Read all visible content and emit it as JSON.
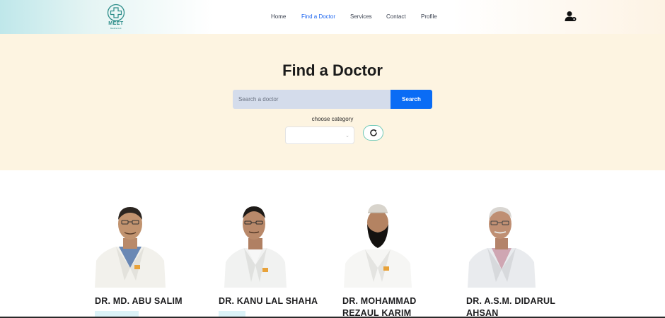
{
  "brand": {
    "logo_text": "MEET",
    "logo_subtext": "Medical Ltd."
  },
  "nav": {
    "items": [
      {
        "label": "Home"
      },
      {
        "label": "Find a Doctor",
        "active": true
      },
      {
        "label": "Services"
      },
      {
        "label": "Contact"
      },
      {
        "label": "Profile"
      }
    ],
    "user_icon": "user-settings-icon"
  },
  "hero": {
    "title": "Find a Doctor",
    "search_placeholder": "Search a doctor",
    "search_button": "Search",
    "category_label": "choose category",
    "category_value": "",
    "refresh_icon": "refresh-icon"
  },
  "doctors": [
    {
      "name_line1": "DR. MD. ABU SALIM",
      "name_line2": ""
    },
    {
      "name_line1": "DR. KANU LAL SHAHA",
      "name_line2": ""
    },
    {
      "name_line1": "DR. MOHAMMAD",
      "name_line2": "REZAUL KARIM"
    },
    {
      "name_line1": "DR. A.S.M. DIDARUL",
      "name_line2": "AHSAN"
    }
  ],
  "colors": {
    "accent": "#0a6cf5",
    "hero_bg": "#fdf4e1",
    "active_nav": "#1a64f0",
    "brand_teal": "#2c8d89"
  }
}
